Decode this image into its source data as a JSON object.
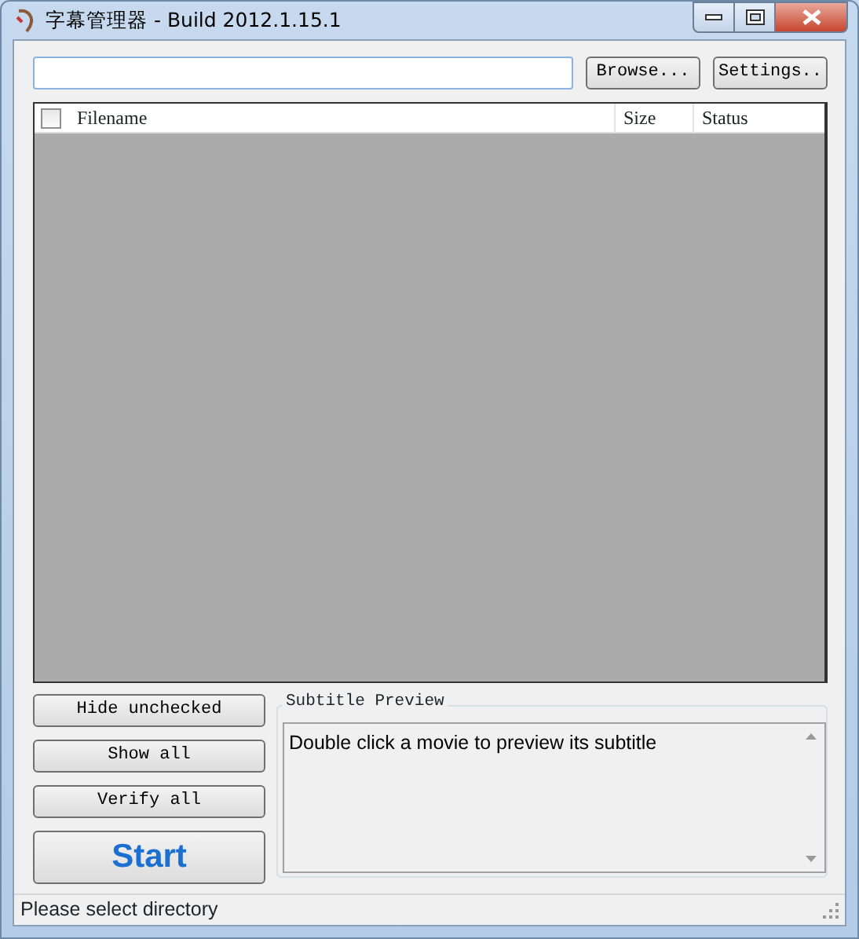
{
  "window": {
    "title": "字幕管理器 - Build 2012.1.15.1"
  },
  "toolbar": {
    "buttons": [
      {
        "label": "Browse..."
      },
      {
        "label": "Settings.."
      }
    ]
  },
  "file_list": {
    "select_all_checked": false,
    "columns": [
      {
        "label": "Filename"
      },
      {
        "label": "Size"
      },
      {
        "label": "Status"
      }
    ]
  },
  "actions": [
    {
      "label": "Hide unchecked",
      "kind": "small"
    },
    {
      "label": "Show all",
      "kind": "small"
    },
    {
      "label": "Verify all",
      "kind": "small"
    },
    {
      "label": "Start",
      "kind": "big"
    }
  ],
  "subtitle_preview": {
    "title": "Subtitle Preview",
    "text": "Double click a movie to preview its subtitle"
  },
  "status_bar": {
    "text": "Please select directory"
  }
}
